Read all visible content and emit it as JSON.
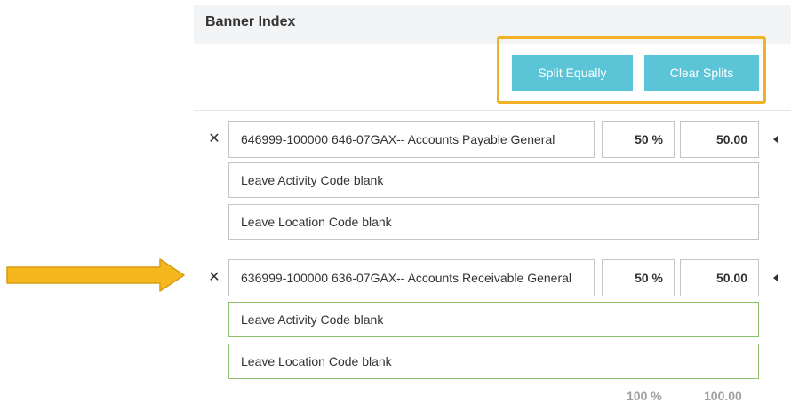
{
  "header": {
    "title": "Banner Index"
  },
  "toolbar": {
    "split_equally": "Split Equally",
    "clear_splits": "Clear Splits"
  },
  "highlight_color": "#f2b125",
  "accent_color": "#5bc4d6",
  "rows": [
    {
      "remove": "✕",
      "index_value": "646999-100000 646-07GAX-- Accounts Payable General",
      "percent": "50 %",
      "amount": "50.00",
      "activity": "Leave Activity Code blank",
      "location": "Leave Location Code blank"
    },
    {
      "remove": "✕",
      "index_value": "636999-100000 636-07GAX-- Accounts Receivable General",
      "percent": "50 %",
      "amount": "50.00",
      "activity": "Leave Activity Code blank",
      "location": "Leave Location Code blank"
    }
  ],
  "totals": {
    "percent": "100 %",
    "amount": "100.00"
  }
}
